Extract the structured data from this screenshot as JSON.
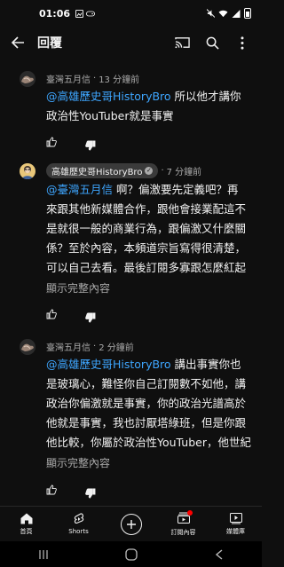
{
  "status_bar": {
    "time": "01:06",
    "left_icons": [
      "gallery-icon",
      "game-icon"
    ],
    "right_icons": [
      "mute-icon",
      "wifi-icon",
      "signal-icon",
      "battery-icon"
    ]
  },
  "app_bar": {
    "title": "回覆",
    "icons": [
      "back-arrow-icon",
      "cast-icon",
      "search-icon",
      "more-vert-icon"
    ]
  },
  "comments": [
    {
      "author": "臺灣五月信",
      "time": "13 分鐘前",
      "mention": "@高雄歷史哥HistoryBro",
      "lines": [
        "所以他才講你",
        "政治性YouTuber就是事實"
      ],
      "show_more": "",
      "creator": false
    },
    {
      "author": "高雄歷史哥HistoryBro",
      "time": "7 分鐘前",
      "mention": "@臺灣五月信",
      "lines": [
        "啊？偏激要先定義吧？再",
        "來跟其他新媒體合作，跟他會接業配這不",
        "是就很一般的商業行為，跟偏激又什麼關",
        "係？至於內容，本頻道宗旨寫得很清楚，",
        "可以自己去看。最後訂閱多寡跟怎麼紅起"
      ],
      "show_more": "顯示完整內容",
      "creator": true
    },
    {
      "author": "臺灣五月信",
      "time": "2 分鐘前",
      "mention": "@高雄歷史哥HistoryBro",
      "lines": [
        "講出事實你也",
        "是玻璃心，難怪你自己訂閱數不如他，講",
        "政治你偏激就是事實，你的政治光譜高於",
        "他就是事實，我也討厭塔綠班，但是你跟",
        "他比較，你屬於政治性YouTuber，他世紀"
      ],
      "show_more": "顯示完整內容",
      "creator": false
    }
  ],
  "bottom_nav": [
    {
      "label": "首頁",
      "icon": "home-icon"
    },
    {
      "label": "Shorts",
      "icon": "shorts-icon"
    },
    {
      "label": "",
      "icon": "create-icon"
    },
    {
      "label": "訂閱內容",
      "icon": "subscriptions-icon"
    },
    {
      "label": "媒體庫",
      "icon": "library-icon"
    }
  ],
  "colors": {
    "background": "#0f0f0f",
    "mention": "#3ea6ff",
    "secondary_text": "#aaaaaa",
    "notification_dot": "#ff0000"
  }
}
